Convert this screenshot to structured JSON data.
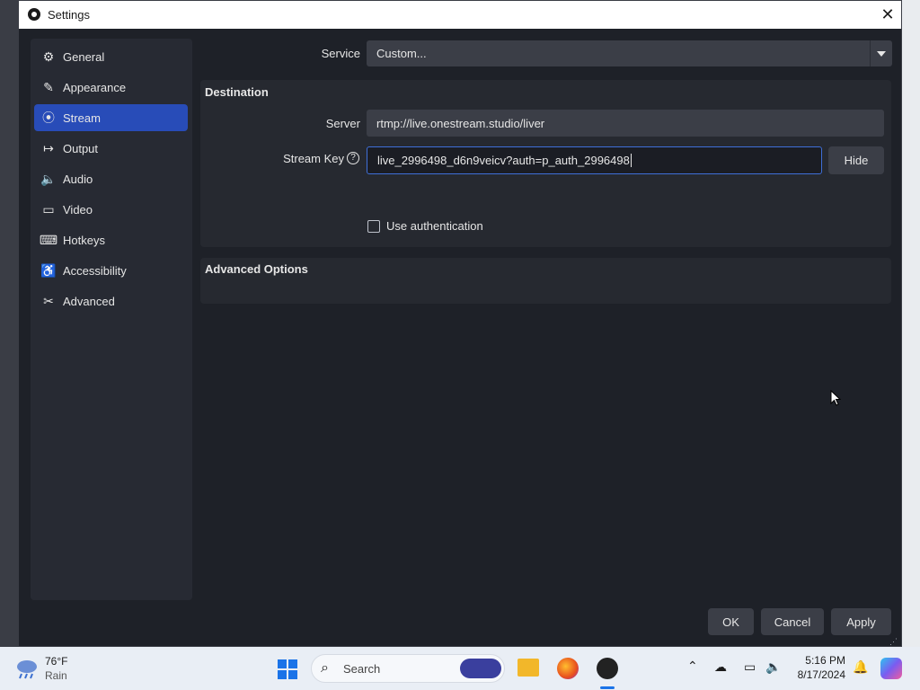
{
  "window": {
    "title": "Settings",
    "close_glyph": "✕"
  },
  "sidebar": {
    "items": [
      {
        "label": "General",
        "icon": "gear-icon",
        "glyph": "⚙"
      },
      {
        "label": "Appearance",
        "icon": "appearance-icon",
        "glyph": "✎"
      },
      {
        "label": "Stream",
        "icon": "broadcast-icon",
        "glyph": "⦿"
      },
      {
        "label": "Output",
        "icon": "output-icon",
        "glyph": "↦"
      },
      {
        "label": "Audio",
        "icon": "speaker-icon",
        "glyph": "🔈"
      },
      {
        "label": "Video",
        "icon": "monitor-icon",
        "glyph": "▭"
      },
      {
        "label": "Hotkeys",
        "icon": "keyboard-icon",
        "glyph": "⌨"
      },
      {
        "label": "Accessibility",
        "icon": "accessibility-icon",
        "glyph": "♿"
      },
      {
        "label": "Advanced",
        "icon": "tools-icon",
        "glyph": "✂"
      }
    ],
    "active_index": 2
  },
  "stream": {
    "service_label": "Service",
    "service_value": "Custom...",
    "destination_title": "Destination",
    "server_label": "Server",
    "server_value": "rtmp://live.onestream.studio/liver",
    "stream_key_label": "Stream Key",
    "stream_key_value": "live_2996498_d6n9veicv?auth=p_auth_2996498",
    "hide_button": "Hide",
    "use_auth_label": "Use authentication",
    "use_auth_checked": false,
    "advanced_title": "Advanced Options"
  },
  "footer": {
    "ok": "OK",
    "cancel": "Cancel",
    "apply": "Apply"
  },
  "taskbar": {
    "weather_temp": "76°F",
    "weather_desc": "Rain",
    "search_placeholder": "Search",
    "time": "5:16 PM",
    "date": "8/17/2024"
  },
  "colors": {
    "accent": "#284cb8",
    "window_bg": "#1e2128",
    "field_bg": "#3b3e47"
  }
}
